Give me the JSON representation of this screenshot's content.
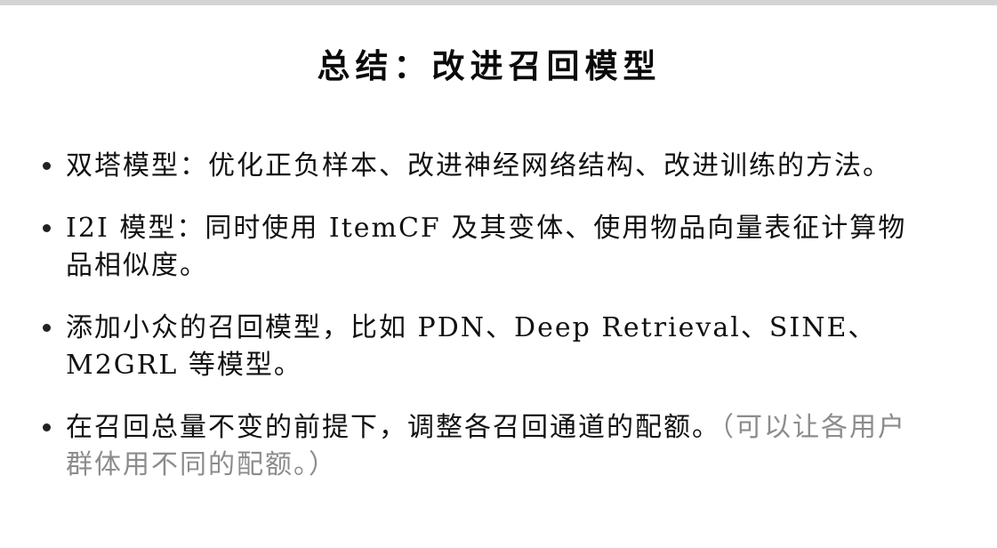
{
  "slide": {
    "title": "总结：改进召回模型"
  },
  "bullets": [
    {
      "text": "双塔模型：优化正负样本、改进神经网络结构、改进训练的方法。"
    },
    {
      "text": "I2I 模型：同时使用 ItemCF 及其变体、使用物品向量表征计算物品相似度。"
    },
    {
      "text": "添加小众的召回模型，比如 PDN、Deep Retrieval、SINE、M2GRL 等模型。"
    },
    {
      "text": "在召回总量不变的前提下，调整各召回通道的配额。",
      "aside": "（可以让各用户群体用不同的配额。）"
    }
  ],
  "colors": {
    "text": "#111111",
    "aside": "#8c8c8c",
    "top_border": "#d4d4d4"
  }
}
